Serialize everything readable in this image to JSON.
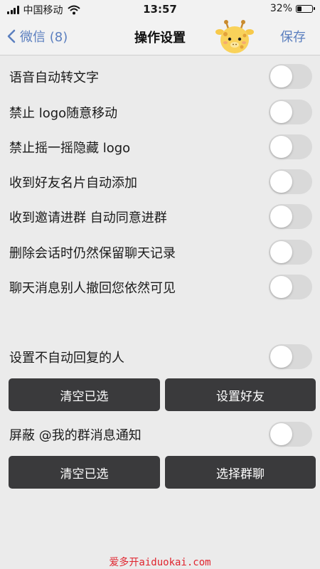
{
  "status_bar": {
    "carrier": "中国移动",
    "time": "13:57",
    "battery_text": "32%",
    "battery_level": 0.32
  },
  "nav": {
    "back_label": "微信 (8)",
    "title": "操作设置",
    "save_label": "保存"
  },
  "settings": [
    {
      "label": "语音自动转文字",
      "enabled": false
    },
    {
      "label": "禁止 logo随意移动",
      "enabled": false
    },
    {
      "label": "禁止摇一摇隐藏 logo",
      "enabled": false
    },
    {
      "label": "收到好友名片自动添加",
      "enabled": false
    },
    {
      "label": "收到邀请进群 自动同意进群",
      "enabled": false
    },
    {
      "label": "删除会话时仍然保留聊天记录",
      "enabled": false
    },
    {
      "label": "聊天消息别人撤回您依然可见",
      "enabled": false
    }
  ],
  "auto_reply": {
    "label": "设置不自动回复的人",
    "enabled": false,
    "clear_label": "清空已选",
    "action_label": "设置好友"
  },
  "mute_at": {
    "label": "屏蔽 @我的群消息通知",
    "enabled": false,
    "clear_label": "清空已选",
    "action_label": "选择群聊"
  },
  "watermark": "爱多开aiduokai.com",
  "colors": {
    "accent": "#5b7fbf",
    "button_bg": "#3a3a3c",
    "toggle_off": "#d9d9d9",
    "background": "#ebebeb",
    "watermark": "#e0242e"
  }
}
